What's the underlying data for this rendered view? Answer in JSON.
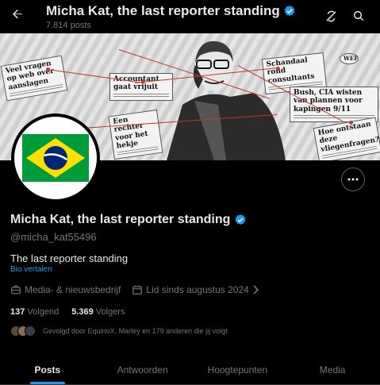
{
  "header": {
    "title": "Micha Kat, the last reporter standing",
    "posts_count": "7.814 posts"
  },
  "banner": {
    "clippings": [
      "Veel vragen op web over aanslagen",
      "Accountant gaat vrijuit",
      "Schandaal rond consultants",
      "Bush, CIA wisten van plannen voor kapingen 9/11",
      "Een rechter voor het hekje",
      "Hoe ontstaan deze vliegenfragen?",
      "WEF"
    ]
  },
  "profile": {
    "name": "Micha Kat, the last reporter standing",
    "handle": "@micha_kat55496",
    "bio": "The last reporter standing",
    "translate_label": "Bio vertalen",
    "category": "Media- & nieuwsbedrijf",
    "joined": "Lid sinds augustus 2024",
    "following_count": "137",
    "following_label": "Volgend",
    "followers_count": "5.369",
    "followers_label": "Volgers",
    "followed_by": "Gevolgd door EquinoX, Marley en 179 anderen die jij volgt"
  },
  "tabs": [
    {
      "label": "Posts",
      "active": true
    },
    {
      "label": "Antwoorden",
      "active": false
    },
    {
      "label": "Hoogtepunten",
      "active": false
    },
    {
      "label": "Media",
      "active": false
    }
  ],
  "colors": {
    "accent": "#1d9bf0",
    "verified": "#1d9bf0",
    "brazil_green": "#009c3b",
    "brazil_yellow": "#ffdf00",
    "brazil_blue": "#002776"
  }
}
